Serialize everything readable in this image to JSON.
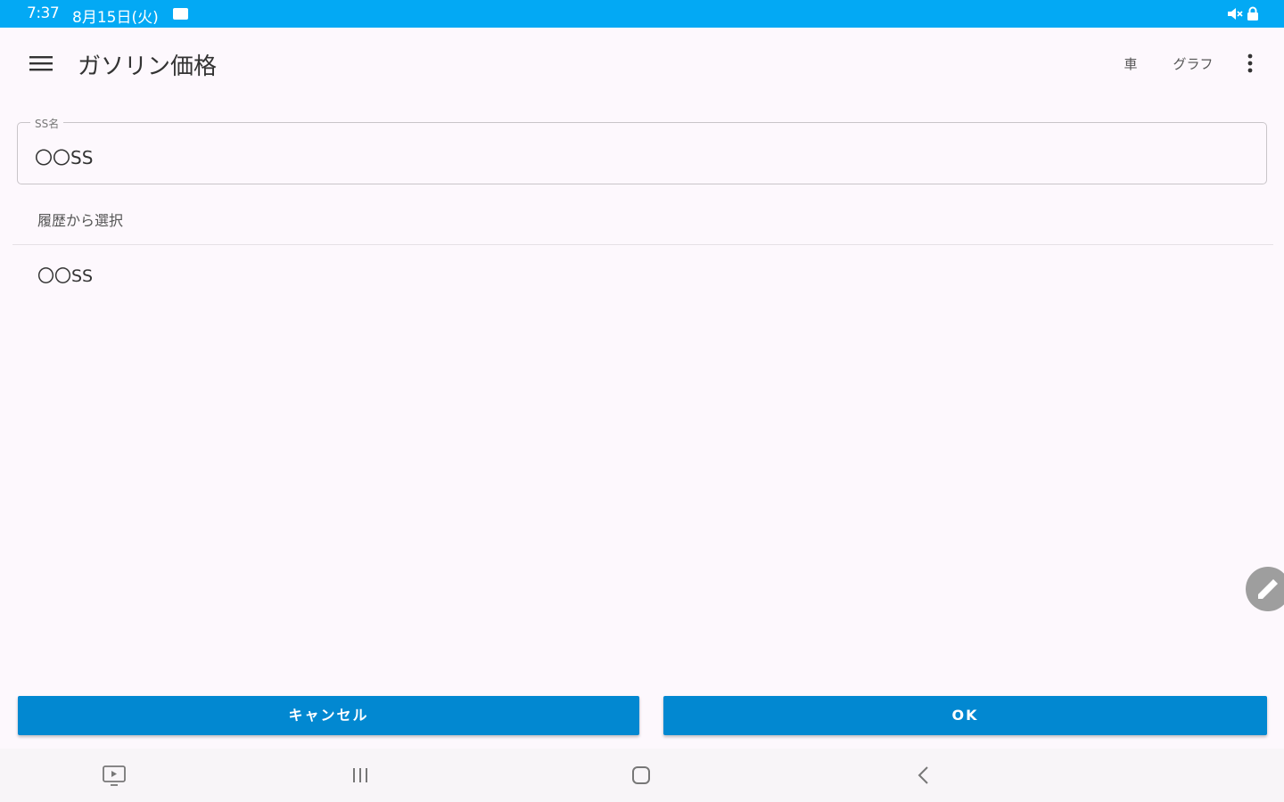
{
  "status_bar": {
    "time": "7:37",
    "date": "8月15日(火)",
    "icons": [
      "notification-icon",
      "volume-mute-icon",
      "lock-icon"
    ]
  },
  "app_bar": {
    "title": "ガソリン価格",
    "menu_icon": "hamburger-menu-icon",
    "actions": {
      "car": "車",
      "graph": "グラフ"
    },
    "more_icon": "more-vert-icon"
  },
  "ss_field": {
    "label": "SS名",
    "value": "〇〇SS"
  },
  "history": {
    "header": "履歴から選択",
    "items": [
      {
        "label": "〇〇SS"
      }
    ]
  },
  "fab": {
    "icon": "edit-pencil-icon"
  },
  "buttons": {
    "cancel": "キャンセル",
    "ok": "OK"
  },
  "colors": {
    "status_bar": "#03a9f4",
    "button": "#0288d1",
    "background": "#fdf8fd",
    "fab": "#9e9e9e"
  },
  "nav_bar": {
    "icons": [
      "screenshot-icon",
      "recent-apps-icon",
      "home-icon",
      "back-icon"
    ]
  }
}
